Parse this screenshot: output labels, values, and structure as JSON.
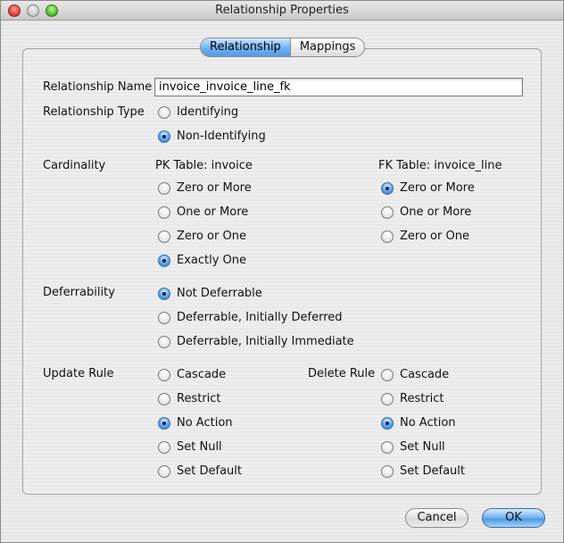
{
  "window": {
    "title": "Relationship Properties"
  },
  "tabs": [
    {
      "label": "Relationship",
      "active": true
    },
    {
      "label": "Mappings",
      "active": false
    }
  ],
  "form": {
    "name_label": "Relationship Name",
    "name_value": "invoice_invoice_line_fk",
    "type_label": "Relationship Type",
    "type_options": [
      {
        "label": "Identifying",
        "selected": false
      },
      {
        "label": "Non-Identifying",
        "selected": true
      }
    ],
    "cardinality_label": "Cardinality",
    "pk_table_label": "PK Table: invoice",
    "fk_table_label": "FK Table: invoice_line",
    "pk_options": [
      {
        "label": "Zero or More",
        "selected": false
      },
      {
        "label": "One or More",
        "selected": false
      },
      {
        "label": "Zero or One",
        "selected": false
      },
      {
        "label": "Exactly One",
        "selected": true
      }
    ],
    "fk_options": [
      {
        "label": "Zero or More",
        "selected": true
      },
      {
        "label": "One or More",
        "selected": false
      },
      {
        "label": "Zero or One",
        "selected": false
      }
    ],
    "deferrability_label": "Deferrability",
    "deferrability_options": [
      {
        "label": "Not Deferrable",
        "selected": true
      },
      {
        "label": "Deferrable, Initially Deferred",
        "selected": false
      },
      {
        "label": "Deferrable, Initially Immediate",
        "selected": false
      }
    ],
    "update_rule_label": "Update Rule",
    "update_options": [
      {
        "label": "Cascade",
        "selected": false
      },
      {
        "label": "Restrict",
        "selected": false
      },
      {
        "label": "No Action",
        "selected": true
      },
      {
        "label": "Set Null",
        "selected": false
      },
      {
        "label": "Set Default",
        "selected": false
      }
    ],
    "delete_rule_label": "Delete Rule",
    "delete_options": [
      {
        "label": "Cascade",
        "selected": false
      },
      {
        "label": "Restrict",
        "selected": false
      },
      {
        "label": "No Action",
        "selected": true
      },
      {
        "label": "Set Null",
        "selected": false
      },
      {
        "label": "Set Default",
        "selected": false
      }
    ]
  },
  "buttons": {
    "cancel": "Cancel",
    "ok": "OK"
  }
}
